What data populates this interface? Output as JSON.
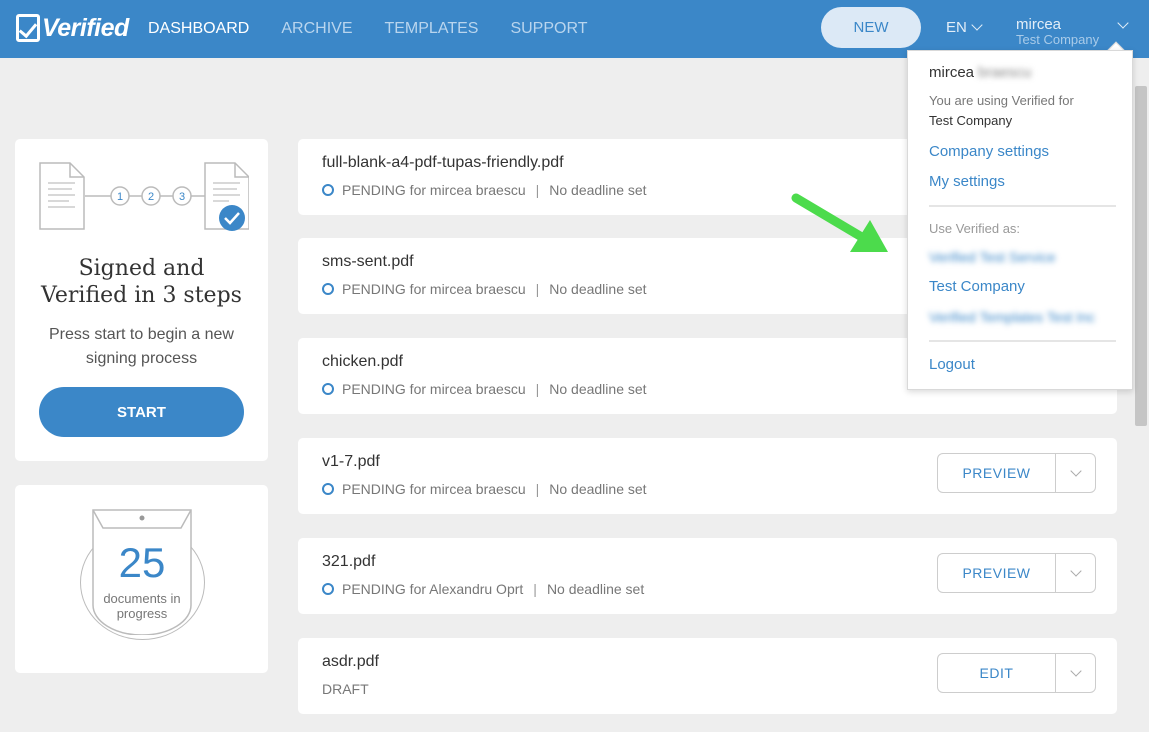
{
  "app": {
    "logo_text": "Verified",
    "brand_color": "#3b87c8"
  },
  "nav": {
    "items": [
      {
        "label": "DASHBOARD",
        "active": true
      },
      {
        "label": "ARCHIVE",
        "active": false
      },
      {
        "label": "TEMPLATES",
        "active": false
      },
      {
        "label": "SUPPORT",
        "active": false
      }
    ],
    "new_label": "NEW",
    "language": "EN",
    "user_name": "mircea",
    "user_company": "Test Company"
  },
  "steps_card": {
    "steps": [
      "1",
      "2",
      "3"
    ],
    "title_line1": "Signed and",
    "title_line2": "Verified in 3 steps",
    "subtitle": "Press start to begin a new signing process",
    "start_label": "START"
  },
  "count_card": {
    "count": "25",
    "label": "documents in progress"
  },
  "documents": [
    {
      "name": "full-blank-a4-pdf-tupas-friendly.pdf",
      "status": "PENDING for mircea braescu",
      "deadline": "No deadline set",
      "action": "",
      "pending": true
    },
    {
      "name": "sms-sent.pdf",
      "status": "PENDING for mircea braescu",
      "deadline": "No deadline set",
      "action": "",
      "pending": true
    },
    {
      "name": "chicken.pdf",
      "status": "PENDING for mircea braescu",
      "deadline": "No deadline set",
      "action": "",
      "pending": true
    },
    {
      "name": "v1-7.pdf",
      "status": "PENDING for mircea braescu",
      "deadline": "No deadline set",
      "action": "PREVIEW",
      "pending": true
    },
    {
      "name": "321.pdf",
      "status": "PENDING for Alexandru Oprt",
      "deadline": "No deadline set",
      "action": "PREVIEW",
      "pending": true
    },
    {
      "name": "asdr.pdf",
      "status": "DRAFT",
      "deadline": "",
      "action": "EDIT",
      "pending": false
    }
  ],
  "dropdown": {
    "name": "mircea",
    "name_blurred": "braescu",
    "using_text": "You are using Verified for",
    "using_company": "Test Company",
    "company_settings": "Company settings",
    "my_settings": "My settings",
    "use_as_label": "Use Verified as:",
    "accounts": [
      {
        "label": "Verified Test Service",
        "blurred": true
      },
      {
        "label": "Test Company",
        "blurred": false
      },
      {
        "label": "Verified Templates Test Inc",
        "blurred": true
      }
    ],
    "logout": "Logout"
  },
  "icons": {
    "pending": "pending-circle-icon",
    "chevron": "chevron-down-icon",
    "check": "check-badge-icon",
    "arrow": "green-arrow-icon"
  }
}
